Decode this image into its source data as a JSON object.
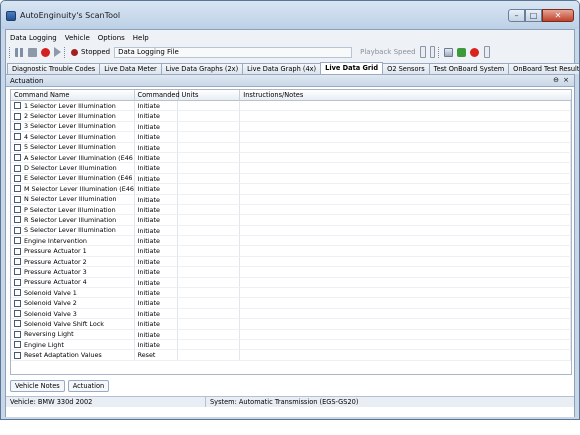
{
  "window": {
    "title": "AutoEnginuity's ScanTool"
  },
  "menubar": [
    "Data Logging",
    "Vehicle",
    "Options",
    "Help"
  ],
  "toolbar": {
    "status_text": "Stopped",
    "file_field_value": "Data Logging File",
    "playback_speed_label": "Playback Speed"
  },
  "tabs": [
    {
      "label": "Diagnostic Trouble Codes",
      "active": false
    },
    {
      "label": "Live Data Meter",
      "active": false
    },
    {
      "label": "Live Data Graphs (2x)",
      "active": false
    },
    {
      "label": "Live Data Graph (4x)",
      "active": false
    },
    {
      "label": "Live Data Grid",
      "active": true
    },
    {
      "label": "O2 Sensors",
      "active": false
    },
    {
      "label": "Test OnBoard System",
      "active": false
    },
    {
      "label": "OnBoard Test Results",
      "active": false
    }
  ],
  "panel": {
    "title": "Actuation"
  },
  "grid": {
    "columns": [
      "Command Name",
      "Commanded",
      "Units",
      "Instructions/Notes"
    ],
    "rows": [
      {
        "name": "1 Selector Lever Illumination",
        "commanded": "Initiate"
      },
      {
        "name": "2 Selector Lever Illumination",
        "commanded": "Initiate"
      },
      {
        "name": "3 Selector Lever Illumination",
        "commanded": "Initiate"
      },
      {
        "name": "4 Selector Lever Illumination",
        "commanded": "Initiate"
      },
      {
        "name": "5 Selector Lever Illumination",
        "commanded": "Initiate"
      },
      {
        "name": "A Selector Lever Illumination (E46 ...",
        "commanded": "Initiate"
      },
      {
        "name": "D Selector Lever Illumination",
        "commanded": "Initiate"
      },
      {
        "name": "E Selector Lever Illumination (E46 ...",
        "commanded": "Initiate"
      },
      {
        "name": "M Selector Lever Illumination (E46 ...",
        "commanded": "Initiate"
      },
      {
        "name": "N Selector Lever Illumination",
        "commanded": "Initiate"
      },
      {
        "name": "P Selector Lever Illumination",
        "commanded": "Initiate"
      },
      {
        "name": "R Selector Lever Illumination",
        "commanded": "Initiate"
      },
      {
        "name": "S Selector Lever Illumination",
        "commanded": "Initiate"
      },
      {
        "name": "Engine Intervention",
        "commanded": "Initiate"
      },
      {
        "name": "Pressure Actuator 1",
        "commanded": "Initiate"
      },
      {
        "name": "Pressure Actuator 2",
        "commanded": "Initiate"
      },
      {
        "name": "Pressure Actuator 3",
        "commanded": "Initiate"
      },
      {
        "name": "Pressure Actuator 4",
        "commanded": "Initiate"
      },
      {
        "name": "Solenoid Valve 1",
        "commanded": "Initiate"
      },
      {
        "name": "Solenoid Valve 2",
        "commanded": "Initiate"
      },
      {
        "name": "Solenoid Valve 3",
        "commanded": "Initiate"
      },
      {
        "name": "Solenoid Valve Shift Lock",
        "commanded": "Initiate"
      },
      {
        "name": "Reversing Light",
        "commanded": "Initiate"
      },
      {
        "name": "Engine Light",
        "commanded": "Initiate"
      },
      {
        "name": "Reset Adaptation Values",
        "commanded": "Reset"
      }
    ]
  },
  "bottom_tabs": [
    "Vehicle Notes",
    "Actuation"
  ],
  "statusbar": {
    "vehicle": "Vehicle: BMW  330d  2002",
    "system": "System: Automatic Transmission (EGS-GS20)"
  }
}
